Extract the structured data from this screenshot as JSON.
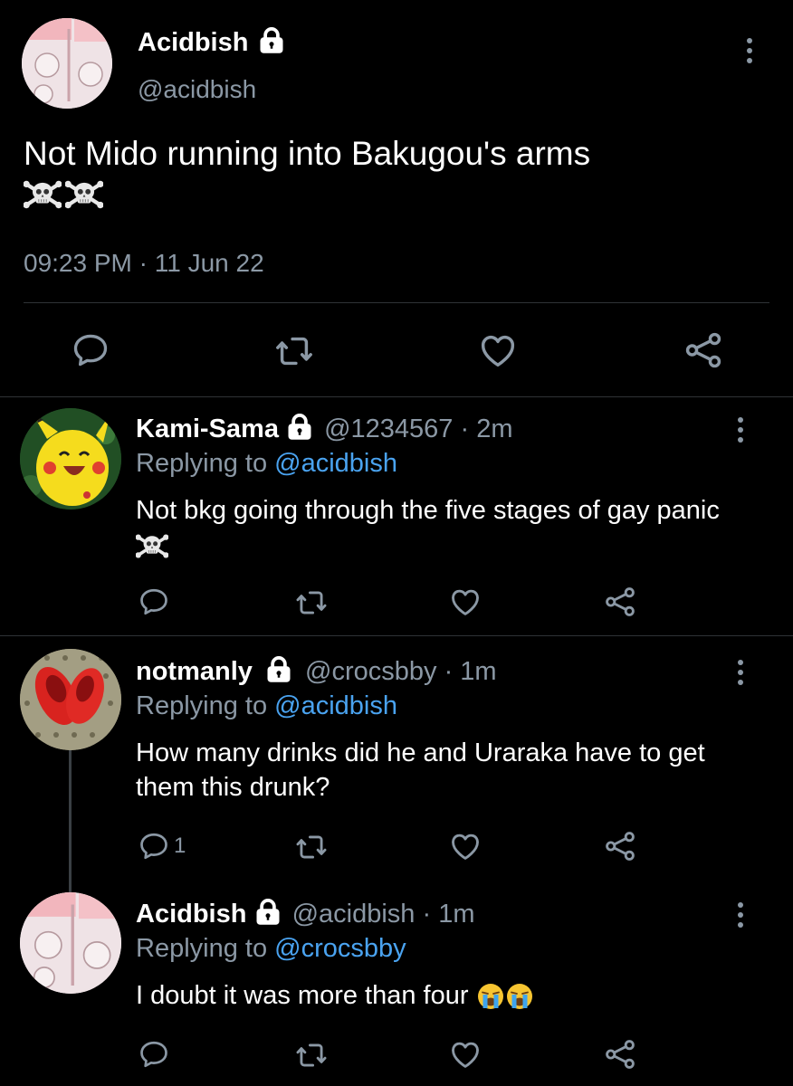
{
  "main_tweet": {
    "display_name": "Acidbish",
    "handle": "@acidbish",
    "text": "Not Mido running into Bakugou's arms",
    "emoji": "☠☠",
    "time": "09:23 PM",
    "date_separator": "·",
    "date": "11 Jun 22"
  },
  "replies": [
    {
      "display_name": "Kami-Sama",
      "handle": "@1234567",
      "age": "· 2m",
      "replying_label": "Replying to",
      "replying_to": "@acidbish",
      "text": "Not bkg going through the five stages of gay panic",
      "emoji": "☠",
      "reply_count": ""
    },
    {
      "display_name": "notmanly",
      "handle": "@crocsbby",
      "age": "· 1m",
      "replying_label": "Replying to",
      "replying_to": "@acidbish",
      "text": "How many drinks did he and Uraraka have to get them this drunk?",
      "emoji": "",
      "reply_count": "1"
    },
    {
      "display_name": "Acidbish",
      "handle": "@acidbish",
      "age": "· 1m",
      "replying_label": "Replying to",
      "replying_to": "@crocsbby",
      "text": "I doubt it was more than four",
      "emoji": "😭😭",
      "reply_count": ""
    }
  ],
  "icons": {
    "reply": "reply-icon",
    "retweet": "retweet-icon",
    "like": "heart-icon",
    "share": "share-icon",
    "more": "more-icon",
    "lock": "lock-icon"
  },
  "colors": {
    "background": "#000000",
    "text": "#ffffff",
    "muted": "#8b98a5",
    "link": "#4aa3f0",
    "divider": "#2f3336"
  }
}
